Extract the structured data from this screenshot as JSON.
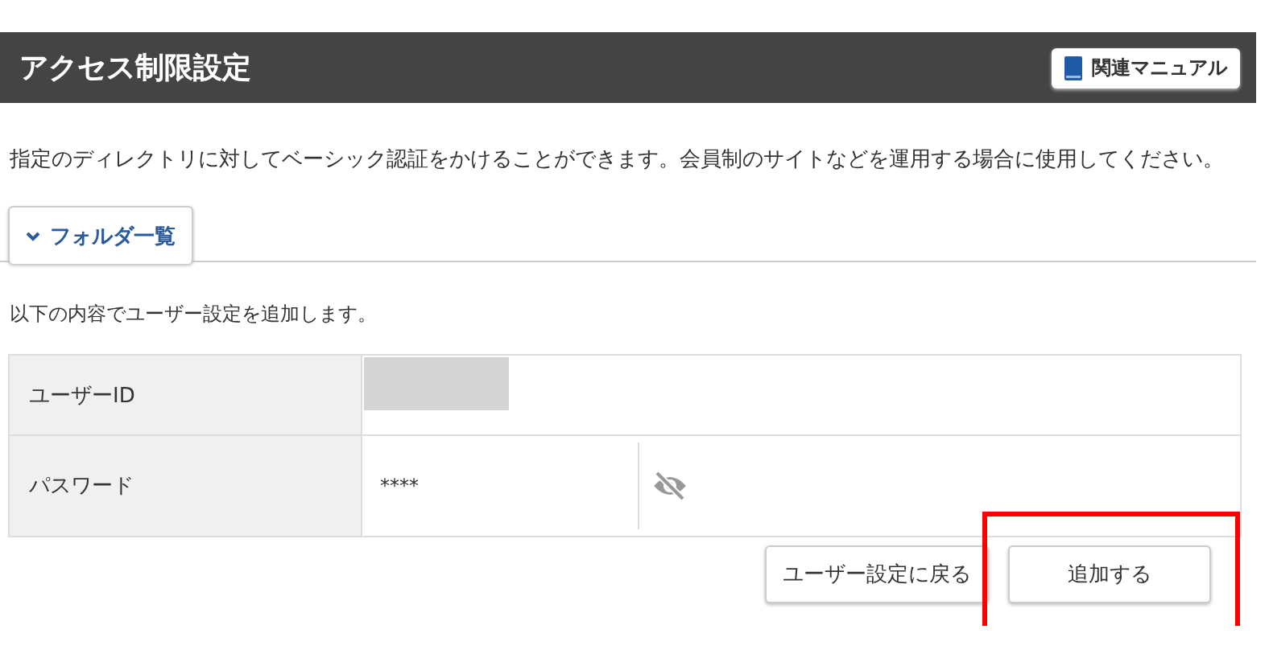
{
  "header": {
    "title": "アクセス制限設定",
    "manual_button": "関連マニュアル"
  },
  "description": "指定のディレクトリに対してベーシック認証をかけることができます。会員制のサイトなどを運用する場合に使用してください。",
  "tabs": [
    {
      "label": "フォルダ一覧",
      "selected": true
    }
  ],
  "intro": "以下の内容でユーザー設定を追加します。",
  "rows": [
    {
      "label": "ユーザーID",
      "kind": "redacted"
    },
    {
      "label": "パスワード",
      "kind": "password",
      "value": "****"
    }
  ],
  "buttons": [
    {
      "label": "ユーザー設定に戻る",
      "highlighted": false
    },
    {
      "label": "追加する",
      "highlighted": true
    }
  ]
}
